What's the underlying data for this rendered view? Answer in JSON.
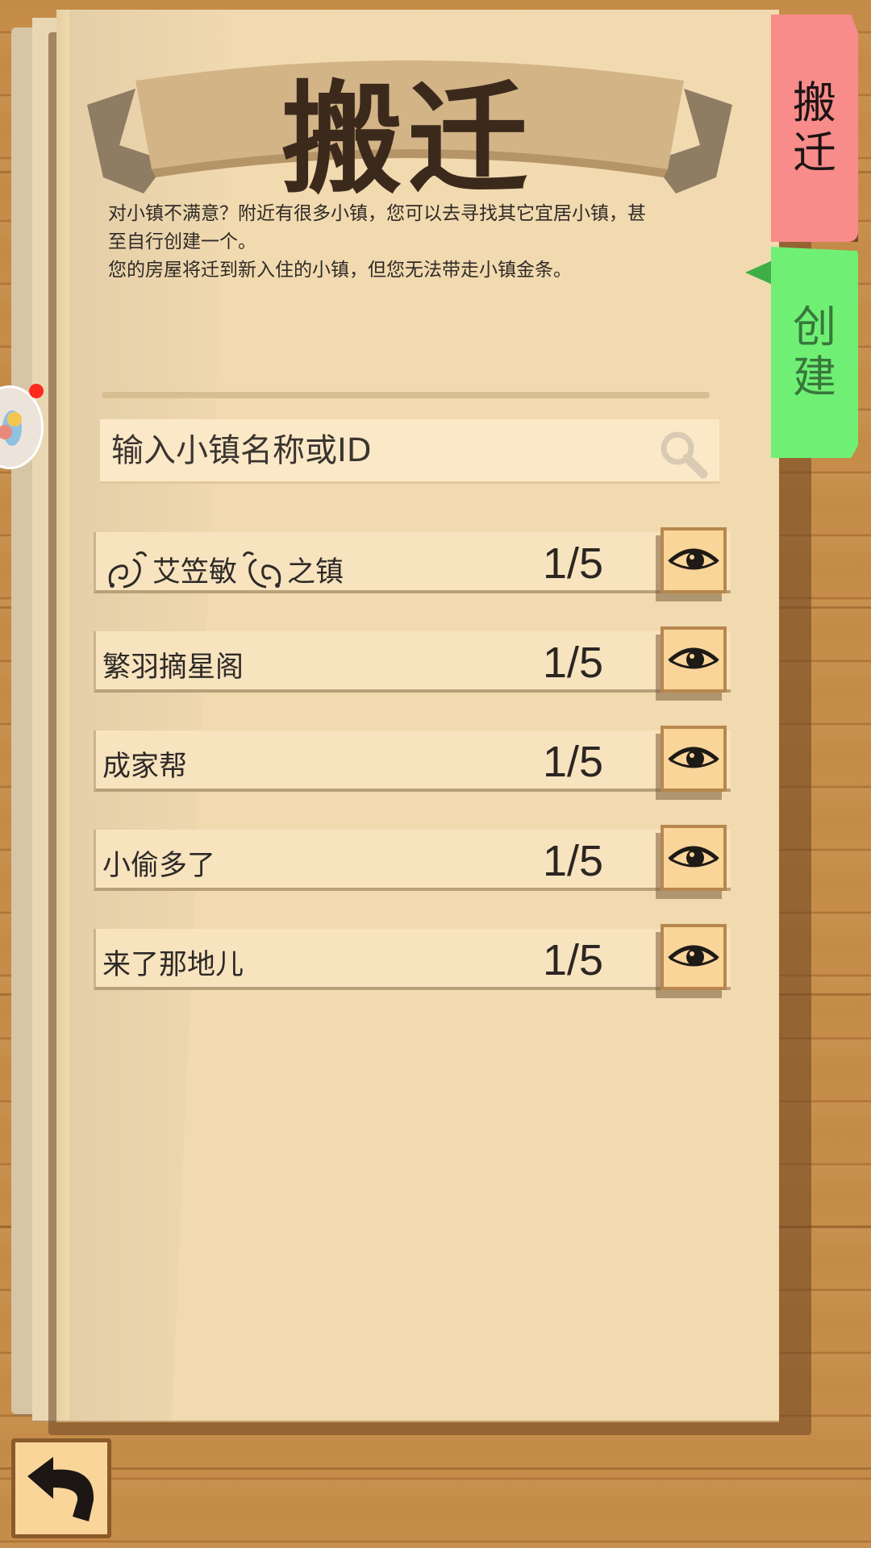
{
  "header": {
    "title": "搬迁",
    "description_lines": [
      "对小镇不满意？附近有很多小镇，您可以去寻找其它宜居小镇，甚",
      "至自行创建一个。",
      "您的房屋将迁到新入住的小镇，但您无法带走小镇金条。"
    ]
  },
  "tabs": [
    {
      "label_line1": "搬",
      "label_line2": "迁",
      "active": true,
      "color": "#f88c8b"
    },
    {
      "label_line1": "创",
      "label_line2": "建",
      "active": false,
      "color": "#6ff075"
    }
  ],
  "search": {
    "placeholder": "输入小镇名称或ID",
    "icon": "search-icon"
  },
  "towns": [
    {
      "name_part1": "艾笠敏",
      "name_part2": "之镇",
      "decorated": true,
      "count": "1/5"
    },
    {
      "name": "繁羽摘星阁",
      "count": "1/5"
    },
    {
      "name": "成家帮",
      "count": "1/5"
    },
    {
      "name": "小偷多了",
      "count": "1/5"
    },
    {
      "name": "来了那地儿",
      "count": "1/5"
    }
  ],
  "icons": {
    "view": "eye-icon",
    "back": "back-arrow-icon"
  }
}
